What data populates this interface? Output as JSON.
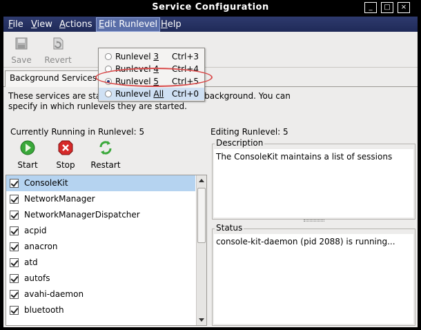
{
  "window": {
    "title": "Service Configuration"
  },
  "menubar": {
    "items": [
      {
        "label": "File",
        "u": "F",
        "rest": "ile"
      },
      {
        "label": "View",
        "u": "V",
        "rest": "iew"
      },
      {
        "label": "Actions",
        "u": "A",
        "rest": "ctions"
      },
      {
        "label": "Edit Runlevel",
        "u": "E",
        "rest": "dit Runlevel"
      },
      {
        "label": "Help",
        "u": "H",
        "rest": "elp"
      }
    ]
  },
  "toolbar": {
    "save_label": "Save",
    "revert_label": "Revert"
  },
  "tabs": [
    {
      "label": "Background Services"
    }
  ],
  "description_text": "These services are started once and run in the background. You can specify in which runlevels they are started.",
  "currently_running": "Currently Running in Runlevel: 5",
  "editing_runlevel": "Editing Runlevel: 5",
  "service_toolbar": {
    "start_label": "Start",
    "stop_label": "Stop",
    "restart_label": "Restart"
  },
  "services": [
    {
      "name": "ConsoleKit",
      "checked": true,
      "selected": true
    },
    {
      "name": "NetworkManager",
      "checked": true
    },
    {
      "name": "NetworkManagerDispatcher",
      "checked": true
    },
    {
      "name": "acpid",
      "checked": true
    },
    {
      "name": "anacron",
      "checked": true
    },
    {
      "name": "atd",
      "checked": true
    },
    {
      "name": "autofs",
      "checked": true
    },
    {
      "name": "avahi-daemon",
      "checked": true
    },
    {
      "name": "bluetooth",
      "checked": true
    }
  ],
  "description_frame": {
    "label": "Description",
    "text": "The ConsoleKit maintains a list of sessions"
  },
  "status_frame": {
    "label": "Status",
    "text": "console-kit-daemon (pid 2088) is running..."
  },
  "runlevel_menu": {
    "items": [
      {
        "label_pre": "Runlevel ",
        "label_u": "3",
        "shortcut": "Ctrl+3",
        "checked": false
      },
      {
        "label_pre": "Runlevel ",
        "label_u": "4",
        "shortcut": "Ctrl+4",
        "checked": false
      },
      {
        "label_pre": "Runlevel ",
        "label_u": "5",
        "shortcut": "Ctrl+5",
        "checked": true
      },
      {
        "label_pre": "Runlevel ",
        "label_u": "All",
        "shortcut": "Ctrl+0",
        "checked": false
      }
    ]
  },
  "colors": {
    "menubar": "#2e3a6e",
    "selection": "#b5d3f0",
    "highlight_ellipse": "#d94a4a"
  }
}
